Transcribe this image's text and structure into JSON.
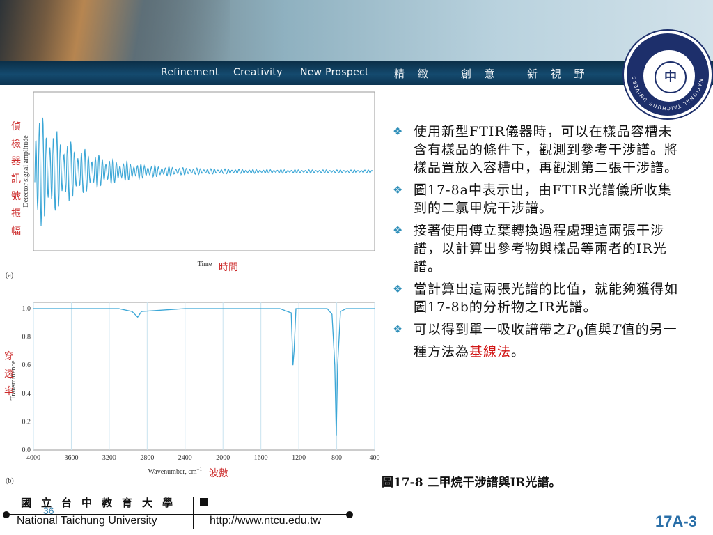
{
  "header": {
    "motto_en": [
      "Refinement",
      "Creativity",
      "New Prospect"
    ],
    "motto_cn": [
      "精 緻",
      "創 意",
      "新 視 野"
    ],
    "logo_text": "NATIONAL TAICHUNG UNIVERSITY",
    "logo_mark": "中"
  },
  "figure_a": {
    "ylabel_en": "Detector signal amplitude",
    "ylabel_cn": [
      "偵",
      "檢",
      "器",
      "訊",
      "號",
      "振",
      "幅"
    ],
    "xlabel_en": "Time",
    "xlabel_cn": "時間",
    "panel": "(a)"
  },
  "figure_b": {
    "ylabel_en": "Transmittance",
    "ylabel_cn": [
      "穿",
      "透",
      "率"
    ],
    "xlabel_en": "Wavenumber, cm",
    "xlabel_sup": "−1",
    "xlabel_cn": "波數",
    "panel": "(b)",
    "yticks": [
      "1.0",
      "0.8",
      "0.6",
      "0.4",
      "0.2",
      "0.0"
    ],
    "xticks": [
      "4000",
      "3600",
      "3200",
      "2800",
      "2400",
      "2000",
      "1600",
      "1200",
      "800",
      "400"
    ]
  },
  "chart_data": [
    {
      "type": "line",
      "title": "",
      "xlabel": "Time",
      "ylabel": "Detector signal amplitude",
      "description_series": "interferogram: damped oscillation centred at zero, decaying with time"
    },
    {
      "type": "line",
      "xlabel": "Wavenumber, cm−1",
      "ylabel": "Transmittance",
      "xlim": [
        4000,
        400
      ],
      "ylim": [
        0.0,
        1.0
      ],
      "series": [
        {
          "x": [
            4000,
            3100,
            2960,
            2900,
            2860,
            2400,
            1400,
            1280,
            1262,
            1250,
            1230,
            1100,
            900,
            850,
            820,
            805,
            790,
            760,
            700,
            500,
            400
          ],
          "y": [
            1.0,
            1.0,
            0.98,
            0.94,
            0.98,
            1.0,
            1.0,
            0.97,
            0.6,
            0.7,
            1.0,
            1.0,
            1.0,
            0.96,
            0.6,
            0.1,
            0.6,
            0.98,
            1.0,
            1.0,
            1.0
          ]
        }
      ]
    }
  ],
  "bullets": [
    {
      "text": "使用新型FTIR儀器時，可以在樣品容槽未含有樣品的條件下，觀測到參考干涉譜。將樣品置放入容槽中，再觀測第二張干涉譜。"
    },
    {
      "text": "圖17-8a中表示出，由FTIR光譜儀所收集到的二氯甲烷干涉譜。"
    },
    {
      "text": "接著使用傅立葉轉換過程處理這兩張干涉譜，以計算出參考物與樣品等兩者的IR光譜。"
    },
    {
      "text": "當計算出這兩張光譜的比值，就能夠獲得如圖17-8b的分析物之IR光譜。"
    },
    {
      "pre": "可以得到單一吸收譜帶之",
      "p0": "P",
      "p0sub": "0",
      "mid1": "值與",
      "t": "T",
      "mid2": "值的另一種方法為",
      "red": "基線法",
      "post": "。"
    }
  ],
  "caption": "圖17-8 二甲烷干涉譜與IR光譜。",
  "footer": {
    "univ_cn": "國立台中教育大學",
    "univ_en": "National Taichung University",
    "url": "http://www.ntcu.edu.tw",
    "page": "36",
    "slide_id": "17A-3"
  },
  "colors": {
    "accent": "#2f8fb9",
    "trace": "#3aa6d6",
    "highlight": "#d11414",
    "navy": "#0d3552"
  }
}
